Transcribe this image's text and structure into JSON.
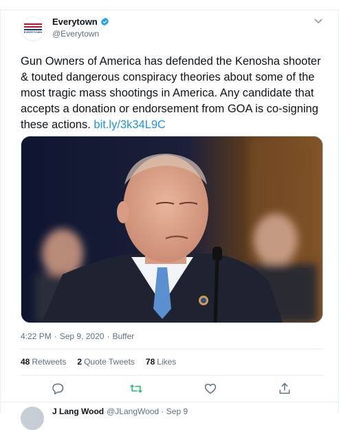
{
  "tweet": {
    "display_name": "Everytown",
    "handle": "@Everytown",
    "avatar_logo_text": "EVERYTOWN",
    "text": "Gun Owners of America has defended the Kenosha shooter & touted dangerous conspiracy theories about some of the most tragic mass shootings in America. Any candidate that accepts a donation or endorsement from GOA is co-signing these actions. ",
    "link": "bit.ly/3k34L9C",
    "time": "4:22 PM",
    "date": "Sep 9, 2020",
    "source": "Buffer",
    "retweets_count": "48",
    "retweets_label": "Retweets",
    "quote_count": "2",
    "quote_label": "Quote Tweets",
    "likes_count": "78",
    "likes_label": "Likes"
  },
  "next_tweet": {
    "display_name": "J Lang Wood",
    "handle": "@JLangWood",
    "date": "Sep 9"
  },
  "icons": {
    "verified": "verified-badge-icon",
    "menu": "chevron-down-icon",
    "reply": "reply-icon",
    "retweet": "retweet-icon",
    "like": "heart-icon",
    "share": "share-icon"
  },
  "colors": {
    "link": "#1b95e0",
    "retweet_icon": "#17bf63",
    "secondary_text": "#5b7083",
    "verified": "#1da1f2"
  }
}
